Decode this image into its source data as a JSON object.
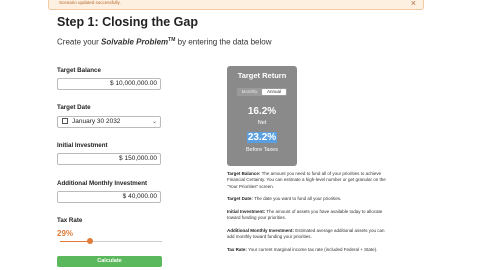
{
  "toast": {
    "message": "Scenario updated successfully.",
    "close": "×"
  },
  "page": {
    "title": "Step 1: Closing the Gap",
    "subtitle_pre": "Create your ",
    "subtitle_em": "Solvable Problem",
    "subtitle_tm": "TM",
    "subtitle_post": " by entering the data below"
  },
  "form": {
    "target_balance_label": "Target Balance",
    "target_balance_value": "$ 10,000,000.00",
    "target_date_label": "Target Date",
    "target_date_value": "January 30 2032",
    "initial_investment_label": "Initial Investment",
    "initial_investment_value": "$ 150,000.00",
    "monthly_investment_label": "Additional Monthly Investment",
    "monthly_investment_value": "$ 40,000.00",
    "tax_rate_label": "Tax Rate",
    "tax_rate_value": "29%",
    "tax_rate_fraction": 0.29,
    "calculate_label": "Calculate"
  },
  "target_return": {
    "title": "Target Return",
    "toggle_monthly": "Monthly",
    "toggle_annual": "Annual",
    "net_value": "16.2%",
    "net_label": "Net",
    "before_tax_value": "23.2%",
    "before_tax_label": "Before Taxes"
  },
  "descriptions": [
    {
      "term": "Target Balance:",
      "text": " The amount you need to fund all of your priorities to achieve Financial Certainty. You can estimate a high-level number or get granular on the \"Your Priorities\" screen."
    },
    {
      "term": "Target Date:",
      "text": " The date you want to fund all your priorities."
    },
    {
      "term": "Initial Investment:",
      "text": " The amount of assets you have available today to allocate toward funding your priorities."
    },
    {
      "term": "Additional Monthly Investment:",
      "text": " Estimated average additional assets you can add monthly toward funding your priorities."
    },
    {
      "term": "Tax Rate:",
      "text": " Your current marginal income tax rate (included Federal + State)."
    }
  ],
  "colors": {
    "accent": "#e07b39",
    "button": "#5cb85c",
    "card": "#8a8a8a",
    "highlight": "#5aa0e0"
  }
}
